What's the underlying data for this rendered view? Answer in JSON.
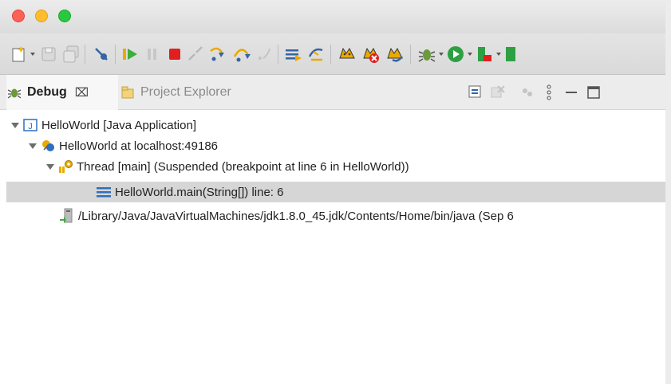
{
  "window": {
    "traffic_lights": [
      "close",
      "minimize",
      "zoom"
    ],
    "colors": {
      "close": "#fe5f57",
      "minimize": "#febc2e",
      "zoom": "#28c840"
    }
  },
  "toolbar": {
    "buttons": [
      "new-wizard-icon",
      "save-icon",
      "save-all-icon",
      "skip-breakpoints-icon",
      "resume-icon",
      "suspend-icon",
      "terminate-icon",
      "disconnect-icon",
      "step-into-icon",
      "step-over-icon",
      "step-return-icon",
      "drop-to-frame-icon",
      "use-step-filters-icon",
      "tomcat-start-icon",
      "tomcat-stop-icon",
      "tomcat-restart-icon",
      "debug-icon",
      "run-icon",
      "external-tools-icon"
    ]
  },
  "tabs": {
    "debug": {
      "label": "Debug",
      "close": "⌧"
    },
    "project_explorer": {
      "label": "Project Explorer"
    }
  },
  "tree": {
    "items": [
      {
        "label": "HelloWorld [Java Application]",
        "icon": "java-application-icon"
      },
      {
        "label": "HelloWorld at localhost:49186",
        "icon": "debug-target-icon"
      },
      {
        "label": "Thread [main] (Suspended (breakpoint at line 6 in HelloWorld))",
        "icon": "suspended-thread-icon"
      },
      {
        "label": "HelloWorld.main(String[]) line: 6",
        "icon": "stack-frame-icon",
        "selected": true
      },
      {
        "label": "/Library/Java/JavaVirtualMachines/jdk1.8.0_45.jdk/Contents/Home/bin/java (Sep 6",
        "icon": "process-icon"
      }
    ]
  },
  "colors": {
    "selection": "#d6d6d6",
    "accent": "#2f6fbf"
  }
}
